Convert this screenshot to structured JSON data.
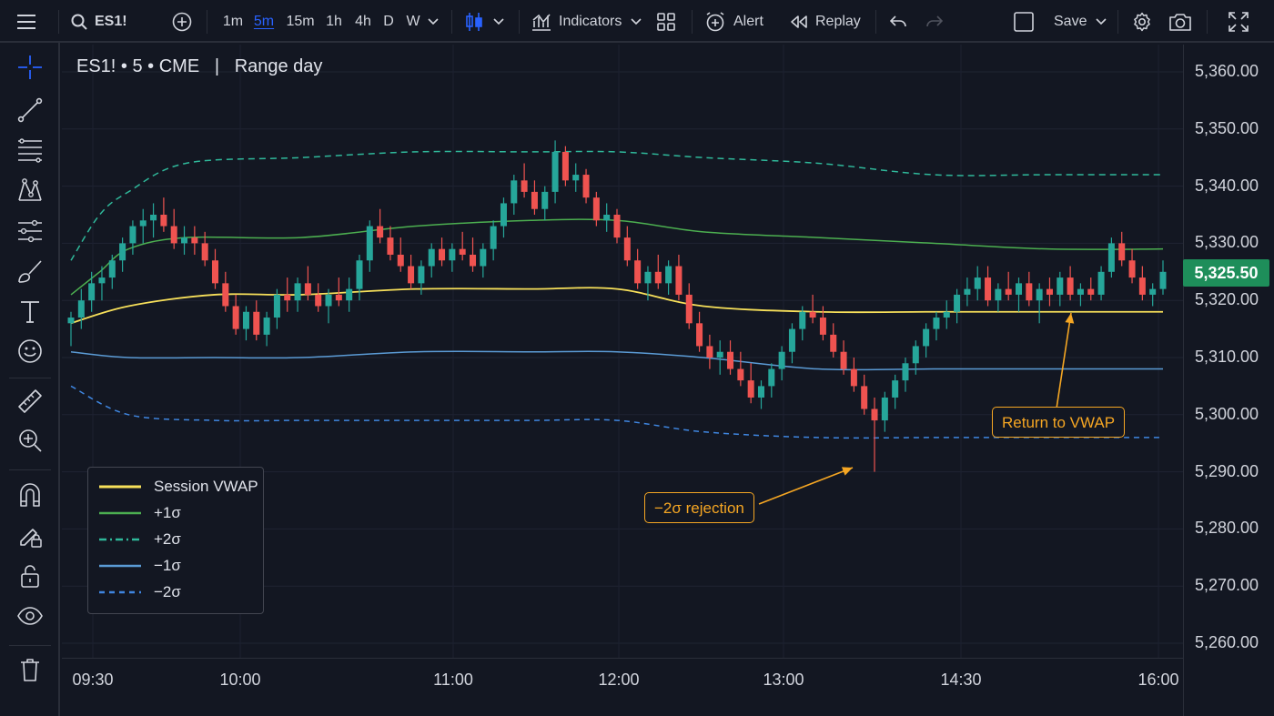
{
  "toolbar": {
    "symbol": "ES1!",
    "intervals": [
      "1m",
      "5m",
      "15m",
      "1h",
      "4h",
      "D",
      "W"
    ],
    "active_interval": "5m",
    "indicators_label": "Indicators",
    "alert_label": "Alert",
    "replay_label": "Replay",
    "save_label": "Save"
  },
  "left_tools": [
    "crosshair-icon",
    "trend-line-icon",
    "fib-levels-icon",
    "pattern-icon",
    "measure-lines-icon",
    "brush-icon",
    "text-icon",
    "emoji-icon",
    "ruler-icon",
    "zoom-in-icon",
    "magnet-icon",
    "lock-drawing-icon",
    "unlock-icon",
    "eye-icon",
    "trash-icon"
  ],
  "chart": {
    "title": "ES1! • 5 • CME   |   Range day",
    "last_price": "5,325.50",
    "price_ticks": [
      "5,360.00",
      "5,350.00",
      "5,340.00",
      "5,330.00",
      "5,320.00",
      "5,310.00",
      "5,300.00",
      "5,290.00",
      "5,280.00",
      "5,270.00",
      "5,260.00"
    ],
    "time_ticks": [
      "09:30",
      "10:00",
      "11:00",
      "12:00",
      "13:00",
      "14:30",
      "16:00"
    ],
    "colors": {
      "up": "#26a69a",
      "down": "#ef5350",
      "vwap": "#f7e05a",
      "plus1": "#4caf50",
      "plus2": "#2fb89a",
      "minus1": "#5b9bd5",
      "minus2": "#3f86e0",
      "accent": "#f5a623",
      "bg": "#131722"
    }
  },
  "legend": {
    "items": [
      {
        "label": "Session VWAP",
        "color": "#f7e05a",
        "dash": "solid"
      },
      {
        "label": "+1σ",
        "color": "#4caf50",
        "dash": "solid"
      },
      {
        "label": "+2σ",
        "color": "#2fb89a",
        "dash": "dashdot"
      },
      {
        "label": "−1σ",
        "color": "#5b9bd5",
        "dash": "solid"
      },
      {
        "label": "−2σ",
        "color": "#3f86e0",
        "dash": "dashed"
      }
    ]
  },
  "annotations": {
    "rejection": "−2σ rejection",
    "return": "Return to VWAP"
  },
  "chart_data": {
    "type": "candlestick",
    "symbol": "ES1!",
    "timeframe": "5",
    "exchange": "CME",
    "x_range": [
      "09:30",
      "16:00"
    ],
    "ylim": [
      5260,
      5360
    ],
    "series": [
      {
        "name": "Session VWAP",
        "points": [
          [
            0,
            5316
          ],
          [
            10,
            5319
          ],
          [
            25,
            5321
          ],
          [
            40,
            5321
          ],
          [
            60,
            5322
          ],
          [
            80,
            5322
          ],
          [
            95,
            5322
          ],
          [
            110,
            5319
          ],
          [
            130,
            5318
          ],
          [
            150,
            5318
          ],
          [
            170,
            5318
          ],
          [
            190,
            5318
          ]
        ]
      },
      {
        "name": "+1σ",
        "points": [
          [
            0,
            5321
          ],
          [
            5,
            5325
          ],
          [
            10,
            5329
          ],
          [
            20,
            5331
          ],
          [
            40,
            5331
          ],
          [
            60,
            5333
          ],
          [
            80,
            5334
          ],
          [
            95,
            5334
          ],
          [
            110,
            5332
          ],
          [
            130,
            5331
          ],
          [
            150,
            5330
          ],
          [
            170,
            5329
          ],
          [
            190,
            5329
          ]
        ]
      },
      {
        "name": "+2σ",
        "points": [
          [
            0,
            5327
          ],
          [
            5,
            5335
          ],
          [
            10,
            5339
          ],
          [
            20,
            5344
          ],
          [
            40,
            5345
          ],
          [
            60,
            5346
          ],
          [
            80,
            5346
          ],
          [
            95,
            5346
          ],
          [
            110,
            5345
          ],
          [
            130,
            5344
          ],
          [
            150,
            5342
          ],
          [
            170,
            5342
          ],
          [
            190,
            5342
          ]
        ]
      },
      {
        "name": "−1σ",
        "points": [
          [
            0,
            5311
          ],
          [
            10,
            5310
          ],
          [
            25,
            5310
          ],
          [
            40,
            5310
          ],
          [
            60,
            5311
          ],
          [
            80,
            5311
          ],
          [
            95,
            5311
          ],
          [
            110,
            5310
          ],
          [
            130,
            5308
          ],
          [
            150,
            5308
          ],
          [
            170,
            5308
          ],
          [
            190,
            5308
          ]
        ]
      },
      {
        "name": "−2σ",
        "points": [
          [
            0,
            5305
          ],
          [
            10,
            5300
          ],
          [
            25,
            5299
          ],
          [
            40,
            5299
          ],
          [
            60,
            5299
          ],
          [
            80,
            5299
          ],
          [
            95,
            5299
          ],
          [
            110,
            5297
          ],
          [
            130,
            5296
          ],
          [
            150,
            5296
          ],
          [
            170,
            5296
          ],
          [
            190,
            5296
          ]
        ]
      }
    ],
    "candles": [
      [
        5316,
        5318,
        5312,
        5317
      ],
      [
        5317,
        5322,
        5315,
        5320
      ],
      [
        5320,
        5325,
        5318,
        5323
      ],
      [
        5323,
        5326,
        5320,
        5324
      ],
      [
        5324,
        5328,
        5322,
        5327
      ],
      [
        5327,
        5331,
        5325,
        5330
      ],
      [
        5330,
        5334,
        5328,
        5333
      ],
      [
        5333,
        5336,
        5330,
        5334
      ],
      [
        5334,
        5337,
        5331,
        5335
      ],
      [
        5335,
        5338,
        5332,
        5333
      ],
      [
        5333,
        5336,
        5329,
        5330
      ],
      [
        5330,
        5333,
        5328,
        5331
      ],
      [
        5331,
        5333,
        5328,
        5330
      ],
      [
        5330,
        5332,
        5326,
        5327
      ],
      [
        5327,
        5329,
        5322,
        5323
      ],
      [
        5323,
        5325,
        5318,
        5319
      ],
      [
        5319,
        5321,
        5314,
        5315
      ],
      [
        5315,
        5319,
        5313,
        5318
      ],
      [
        5318,
        5320,
        5313,
        5314
      ],
      [
        5314,
        5318,
        5312,
        5317
      ],
      [
        5317,
        5322,
        5315,
        5321
      ],
      [
        5321,
        5324,
        5318,
        5320
      ],
      [
        5320,
        5324,
        5318,
        5323
      ],
      [
        5323,
        5326,
        5320,
        5321
      ],
      [
        5321,
        5323,
        5318,
        5319
      ],
      [
        5319,
        5322,
        5316,
        5321
      ],
      [
        5321,
        5324,
        5319,
        5320
      ],
      [
        5320,
        5324,
        5318,
        5322
      ],
      [
        5322,
        5328,
        5320,
        5327
      ],
      [
        5327,
        5334,
        5325,
        5333
      ],
      [
        5333,
        5336,
        5330,
        5331
      ],
      [
        5331,
        5333,
        5327,
        5328
      ],
      [
        5328,
        5331,
        5325,
        5326
      ],
      [
        5326,
        5328,
        5322,
        5323
      ],
      [
        5323,
        5327,
        5321,
        5326
      ],
      [
        5326,
        5330,
        5324,
        5329
      ],
      [
        5329,
        5331,
        5326,
        5327
      ],
      [
        5327,
        5330,
        5325,
        5329
      ],
      [
        5329,
        5332,
        5327,
        5328
      ],
      [
        5328,
        5331,
        5325,
        5326
      ],
      [
        5326,
        5330,
        5324,
        5329
      ],
      [
        5329,
        5334,
        5327,
        5333
      ],
      [
        5333,
        5338,
        5331,
        5337
      ],
      [
        5337,
        5342,
        5335,
        5341
      ],
      [
        5341,
        5344,
        5338,
        5339
      ],
      [
        5339,
        5341,
        5335,
        5336
      ],
      [
        5336,
        5340,
        5334,
        5339
      ],
      [
        5339,
        5348,
        5337,
        5346
      ],
      [
        5346,
        5347,
        5340,
        5341
      ],
      [
        5341,
        5344,
        5339,
        5342
      ],
      [
        5342,
        5343,
        5337,
        5338
      ],
      [
        5338,
        5339,
        5333,
        5334
      ],
      [
        5334,
        5337,
        5332,
        5335
      ],
      [
        5335,
        5336,
        5330,
        5331
      ],
      [
        5331,
        5333,
        5326,
        5327
      ],
      [
        5327,
        5329,
        5322,
        5323
      ],
      [
        5323,
        5326,
        5320,
        5325
      ],
      [
        5325,
        5328,
        5322,
        5323
      ],
      [
        5323,
        5327,
        5321,
        5326
      ],
      [
        5326,
        5328,
        5320,
        5321
      ],
      [
        5321,
        5323,
        5315,
        5316
      ],
      [
        5316,
        5318,
        5311,
        5312
      ],
      [
        5312,
        5314,
        5308,
        5310
      ],
      [
        5310,
        5313,
        5307,
        5311
      ],
      [
        5311,
        5313,
        5307,
        5308
      ],
      [
        5308,
        5311,
        5305,
        5306
      ],
      [
        5306,
        5309,
        5302,
        5303
      ],
      [
        5303,
        5306,
        5301,
        5305
      ],
      [
        5305,
        5309,
        5303,
        5308
      ],
      [
        5308,
        5312,
        5306,
        5311
      ],
      [
        5311,
        5316,
        5309,
        5315
      ],
      [
        5315,
        5319,
        5313,
        5318
      ],
      [
        5318,
        5321,
        5316,
        5317
      ],
      [
        5317,
        5319,
        5313,
        5314
      ],
      [
        5314,
        5316,
        5310,
        5311
      ],
      [
        5311,
        5313,
        5307,
        5308
      ],
      [
        5308,
        5310,
        5304,
        5305
      ],
      [
        5305,
        5307,
        5300,
        5301
      ],
      [
        5301,
        5303,
        5290,
        5299
      ],
      [
        5299,
        5304,
        5297,
        5303
      ],
      [
        5303,
        5307,
        5301,
        5306
      ],
      [
        5306,
        5310,
        5304,
        5309
      ],
      [
        5309,
        5313,
        5307,
        5312
      ],
      [
        5312,
        5316,
        5310,
        5315
      ],
      [
        5315,
        5318,
        5313,
        5317
      ],
      [
        5317,
        5320,
        5315,
        5318
      ],
      [
        5318,
        5322,
        5316,
        5321
      ],
      [
        5321,
        5324,
        5319,
        5322
      ],
      [
        5322,
        5326,
        5320,
        5324
      ],
      [
        5324,
        5326,
        5319,
        5320
      ],
      [
        5320,
        5323,
        5318,
        5322
      ],
      [
        5322,
        5325,
        5320,
        5321
      ],
      [
        5321,
        5324,
        5318,
        5323
      ],
      [
        5323,
        5325,
        5319,
        5320
      ],
      [
        5320,
        5323,
        5316,
        5322
      ],
      [
        5322,
        5324,
        5319,
        5321
      ],
      [
        5321,
        5325,
        5319,
        5324
      ],
      [
        5324,
        5326,
        5320,
        5321
      ],
      [
        5321,
        5323,
        5319,
        5322
      ],
      [
        5322,
        5324,
        5320,
        5321
      ],
      [
        5321,
        5326,
        5320,
        5325
      ],
      [
        5325,
        5331,
        5324,
        5330
      ],
      [
        5330,
        5332,
        5326,
        5327
      ],
      [
        5327,
        5329,
        5323,
        5324
      ],
      [
        5324,
        5326,
        5320,
        5321
      ],
      [
        5321,
        5323,
        5319,
        5322
      ],
      [
        5322,
        5327,
        5321,
        5325
      ]
    ],
    "annotations": [
      {
        "text": "−2σ rejection",
        "target_time": "13:45",
        "target_price": 5290
      },
      {
        "text": "Return to VWAP",
        "target_time": "15:25",
        "target_price": 5319
      }
    ]
  }
}
